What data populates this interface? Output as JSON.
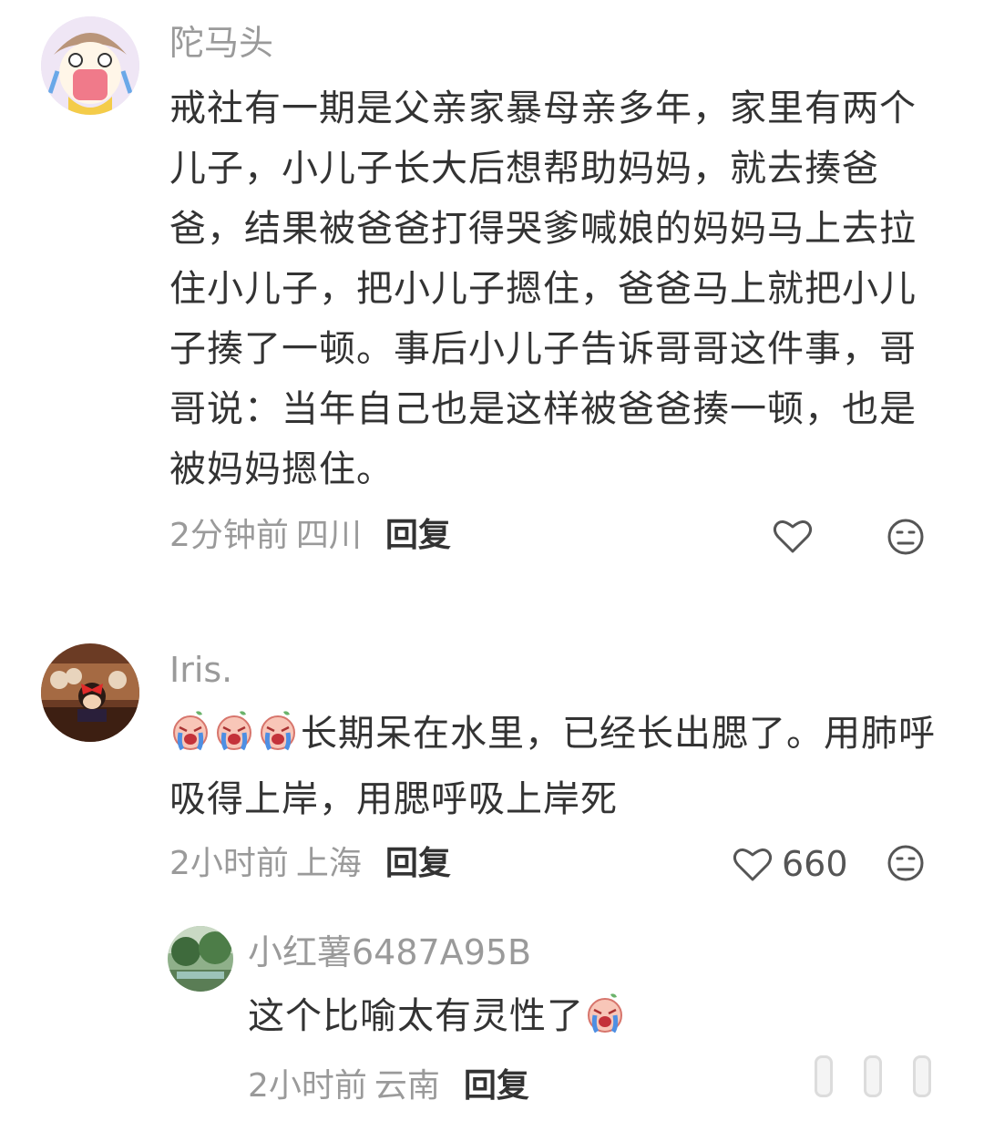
{
  "comments": [
    {
      "username": "陀马头",
      "text": "戒社有一期是父亲家暴母亲多年，家里有两个儿子，小儿子长大后想帮助妈妈，就去揍爸爸，结果被爸爸打得哭爹喊娘的妈妈马上去拉住小儿子，把小儿子摁住，爸爸马上就把小儿子揍了一顿。事后小儿子告诉哥哥这件事，哥哥说：当年自己也是这样被爸爸揍一顿，也是被妈妈摁住。",
      "time": "2分钟前",
      "location": "四川",
      "reply_label": "回复",
      "like_count": ""
    },
    {
      "username": "Iris.",
      "text": "长期呆在水里，已经长出腮了。用肺呼吸得上岸，用腮呼吸上岸死",
      "time": "2小时前",
      "location": "上海",
      "reply_label": "回复",
      "like_count": "660"
    },
    {
      "username": "小红薯6487A95B",
      "text": "这个比喻太有灵性了",
      "time": "2小时前",
      "location": "云南",
      "reply_label": "回复"
    }
  ],
  "icons": {
    "like": "heart-outline-icon",
    "dislike": "neutral-face-icon",
    "crying": "crying-emoji-icon"
  },
  "colors": {
    "text": "#333333",
    "meta": "#9a9a9a",
    "icon": "#555555"
  }
}
